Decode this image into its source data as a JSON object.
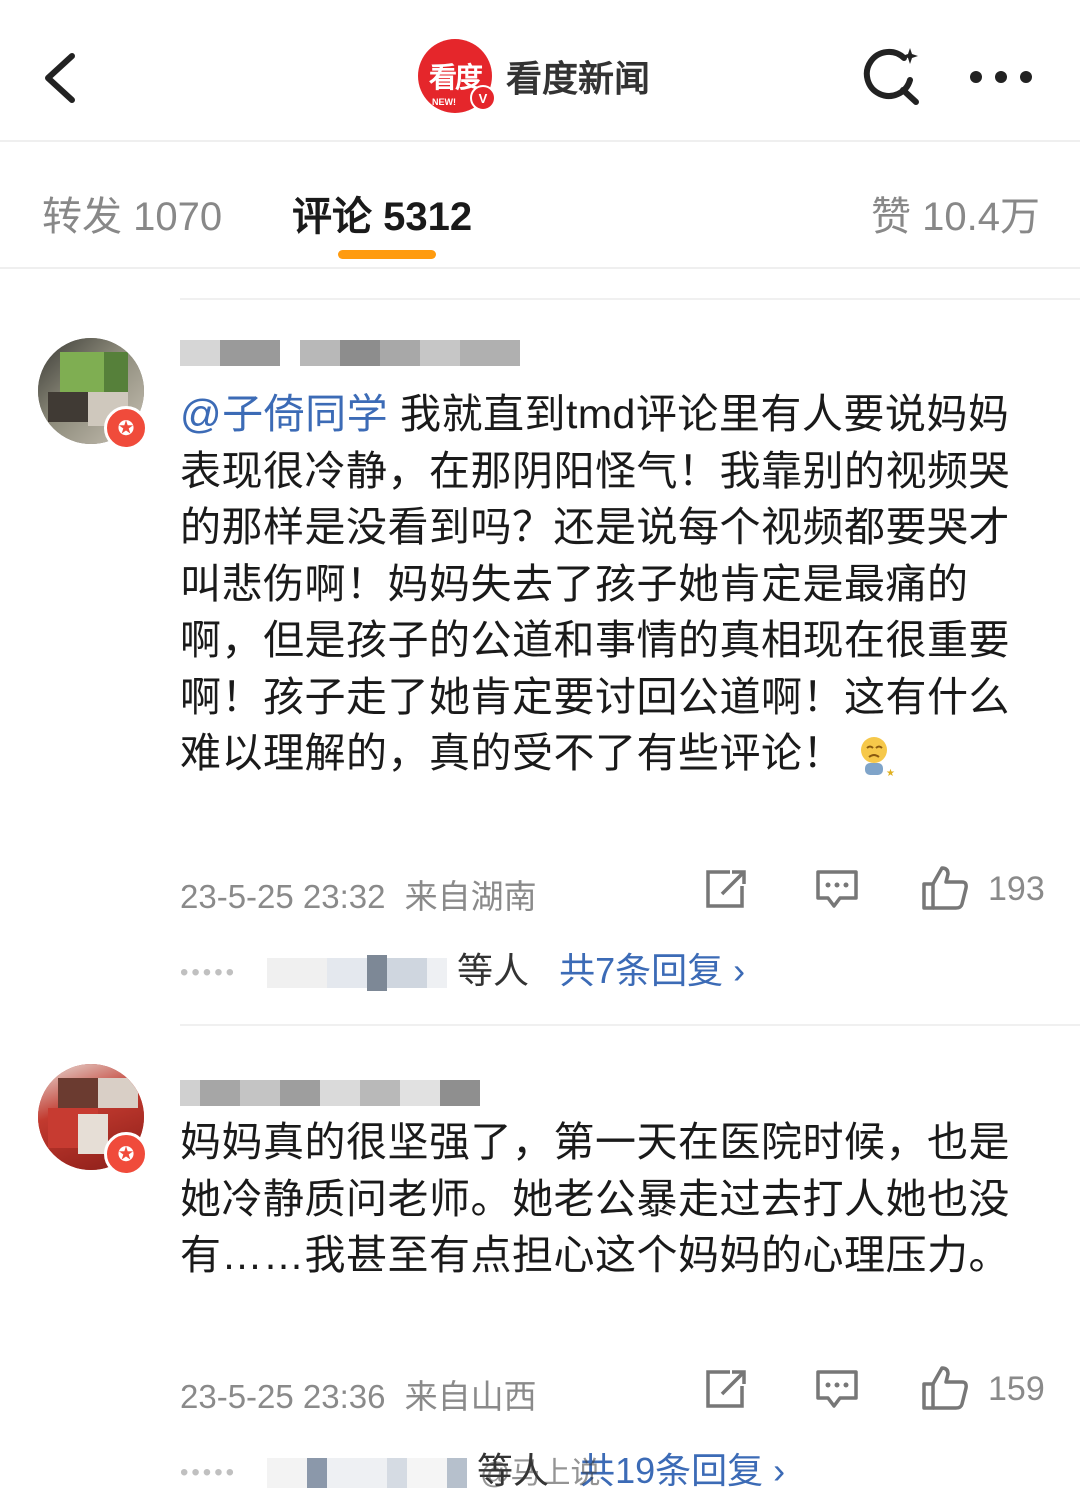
{
  "header": {
    "logo_text": "看度",
    "logo_new": "NEW!",
    "logo_v": "V",
    "brand_name": "看度新闻"
  },
  "tabs": [
    {
      "label": "转发 1070",
      "active": false
    },
    {
      "label": "评论 5312",
      "active": true
    },
    {
      "label": "赞 10.4万",
      "active": false
    }
  ],
  "accent_color": "#ff9b0f",
  "link_color": "#3c6bb6",
  "comments": [
    {
      "mention": "@子倚同学",
      "text": " 我就直到tmd评论里有人要说妈妈表现很冷静，在那阴阳怪气！我靠别的视频哭的那样是没看到吗？还是说每个视频都要哭才叫悲伤啊！妈妈失去了孩子她肯定是最痛的啊，但是孩子的公道和事情的真相现在很重要啊！孩子走了她肯定要讨回公道啊！这有什么难以理解的，真的受不了有些评论！",
      "emoji": "sad-face-emoji",
      "time": "23-5-25 23:32",
      "location": "来自湖南",
      "likes": "193",
      "replies_suffix": "等人",
      "replies_link": "共7条回复 ›"
    },
    {
      "mention": "",
      "text": "妈妈真的很坚强了，第一天在医院时候，也是她冷静质问老师。她老公暴走过去打人她也没有……我甚至有点担心这个妈妈的心理压力。",
      "time": "23-5-25 23:36",
      "location": "来自山西",
      "likes": "159",
      "replies_suffix": "等人",
      "replies_link": "共19条回复 ›"
    }
  ],
  "watermark": "@马上说"
}
